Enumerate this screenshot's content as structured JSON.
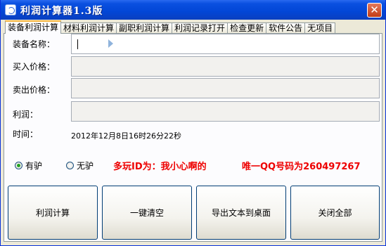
{
  "window": {
    "title": "利润计算器1.3版",
    "close_symbol": "✕"
  },
  "tabs": [
    {
      "label": "装备利润计算",
      "active": true
    },
    {
      "label": "材料利润计算",
      "active": false
    },
    {
      "label": "副职利润计算",
      "active": false
    },
    {
      "label": "利润记录打开",
      "active": false
    },
    {
      "label": "检查更新",
      "active": false
    },
    {
      "label": "软件公告",
      "active": false
    },
    {
      "label": "无项目",
      "active": false
    }
  ],
  "form": {
    "item_name_label": "装备名称：",
    "item_name_value": "",
    "buy_price_label": "买入价格：",
    "buy_price_value": "",
    "sell_price_label": "卖出价格：",
    "sell_price_value": "",
    "profit_label": "利润：",
    "profit_value": "",
    "time_label": "时间：",
    "time_value": "2012年12月8日16时26分22秒"
  },
  "options": {
    "radio_with": "有驴",
    "radio_without": "无驴",
    "selected": "有驴"
  },
  "info": {
    "duowan_id": "多玩ID为：我小心啊的",
    "qq": "唯一QQ号码为260497267"
  },
  "buttons": {
    "calc": "利润计算",
    "clear": "一键清空",
    "export": "导出文本到桌面",
    "close_all": "关闭全部"
  },
  "colors": {
    "titlebar": "#0a50e0",
    "accent_red": "#e00000",
    "tab_highlight": "#f5b540"
  },
  "icons": {
    "app": "app-icon",
    "close": "close-icon",
    "cursor": "cursor-icon"
  }
}
